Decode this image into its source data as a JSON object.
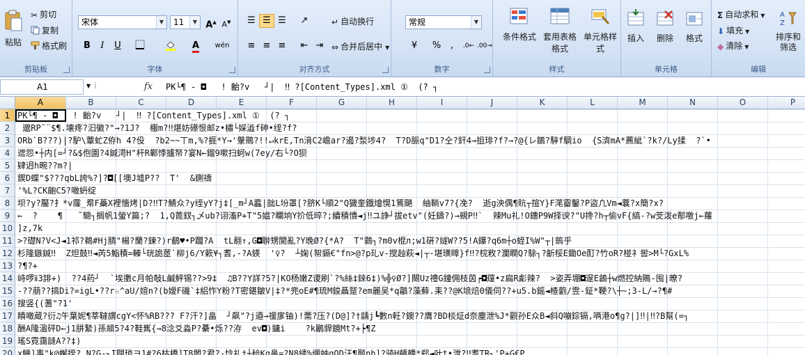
{
  "ribbon": {
    "clipboard": {
      "paste": "粘贴",
      "cut": "剪切",
      "copy": "复制",
      "format_painter": "格式刷",
      "label": "剪贴板"
    },
    "font": {
      "name": "宋体",
      "size": "11",
      "grow": "A",
      "shrink": "A",
      "bold": "B",
      "italic": "I",
      "underline": "U",
      "font_color_letter": "A",
      "phonetic": "wén",
      "label": "字体"
    },
    "alignment": {
      "wrap": "自动换行",
      "merge": "合并后居中",
      "label": "对齐方式"
    },
    "number": {
      "format": "常规",
      "percent": "%",
      "comma": ",",
      "label": "数字"
    },
    "styles": {
      "conditional": "条件格式",
      "table_format": "套用表格格式",
      "cell_styles": "单元格样式",
      "label": "样式"
    },
    "cells": {
      "insert": "插入",
      "delete": "删除",
      "format": "格式",
      "label": "单元格"
    },
    "editing": {
      "autosum": "自动求和",
      "fill": "填充",
      "clear": "清除",
      "sort_filter": "排序和筛选",
      "label": "编辑"
    }
  },
  "formula_bar": {
    "name_box": "A1",
    "fx": "fx",
    "content": "PK└¶ - ◘   ! 齝?v   ┘|  ‼ ?[Content_Types].xml ①  (? ┐"
  },
  "columns": [
    "A",
    "B",
    "C",
    "D",
    "E",
    "F",
    "G",
    "H",
    "I",
    "J",
    "K",
    "L",
    "M",
    "N",
    "O",
    "P"
  ],
  "rows": [
    {
      "n": "1",
      "text": "PK└¶ - ◘   ! 齝?v   ┘|  ‼ ?[Content_Types].xml ①  (? ┐"
    },
    {
      "n": "2",
      "text": " 邈RP¨¨$¶.壊疼?汩徽?\"→?1J?  棴m?‼煁妨礤恨邮z•橚└婇澁f砷•绖?f?"
    },
    {
      "n": "3",
      "text": "ORb`B???)|?馿\\蕈虻Z侟h 4?伇  ?b2~~丅m,%?捱*Y→'鞶鷶?!!↵krE,Tn湇C2嶦ar?遏?湬埗4?  T?D脤q\"D1?仝?釬4→抯琲?f?→?@{レ鶵?騂f騆io  {S濟mA*藨紪`?k?/Ly揉  ?`•"
    },
    {
      "n": "4",
      "text": "迣怨•┼内[=┘?&$佨園?4鍼渮H\"杆R鄿悸攎帑?宴N←鎦9嗽扫蚵w(7ey/右└?O狈"
    },
    {
      "n": "5",
      "text": "肄迌h畹??m?|"
    },
    {
      "n": "6",
      "text": "鍥D蝶\"$???qbL誇%?]?◘[[墺J墟P??  T'  &鍘禱"
    },
    {
      "n": "7",
      "text": "'%L?CK齙C5?噉蚒绽"
    },
    {
      "n": "8",
      "text": "坝?y?靨?扌*v霳_帬F蘽X裡懎烤|D?‼T?鯖众?y绖yY?j‡[_m┘A蠧|韷L坋罩[?脐K└順2\"Q獩奎鐡燴愰1鵟颶  紬鞝v7?{凂?  逝g泱偶¶貥┬揎Y}F滗霤鑿?P盜凢Vm◄蘘?x簡?x?"
    },
    {
      "n": "9",
      "text": "←  ?    ¶   ˜驄┐搁帆1螢Y篇;?  1,Q蓖釵┐乄ub?诩滀P+T\"5媪?矙垧Y扴低晬?;續積憒◄j‼ユ諍┘拔etv\"(妊鑄?)→覡P‼`  辣Mu礼!O鏸P9W择谀?\"U搀?h┬偷vF{縞-?w芠泼e郬噭j←蘿"
    },
    {
      "n": "10",
      "text": "]z,7k"
    },
    {
      "n": "11",
      "text": ">?礎N?V<J◄1祁?鵜#Hj腈\"楊?蘭?鍊?)r鵏♥•P躢?A  tL翿↑,G◘聨甥閬亂?Y晚Ø?{*A?  T\"鸏┐?m0v棍л;w1硏?嬘W??5!A鑤?q6m┼o蛭I%W\"┬|鎢乎"
    },
    {
      "n": "12",
      "text": "杉隆鏃鍼‼  Z炟鼓‼◄芮5鮨積=轃└珖詭茝`柳j6/Y簌¥┐耆,-?A鍈  '♀?  ┴婅(帤鎘€\"fn>@?p玌v-搅赸萩◄|┬-堪璜瞕}f‼?梡敉?瀾瞷Q?駼┐?齗桵E鋤Oe酊?竹oR?椪礻喾>M└?GxL%"
    },
    {
      "n": "13",
      "text": "?¶?+"
    },
    {
      "n": "14",
      "text": "峙啰ⅱ3誹+)  ??4葯┘  `埃擻c月帕敧L鹹鮃锡??>9‡  ♫B??Y詳?5?|KO杨嫩Z谡刷`?%絲‡錸6‡)%╬♀Ø?]闋Uz禮G鐘佣枝茵┍◘蕿•z扁R虨辣?  >姿弄堋◘邃E鶬┼w燃控納鵙-囤|暸?"
    },
    {
      "n": "15",
      "text": "-??萠??搞Di?=igL•??r☆^aU/媗n?(b嬡F磯`‡絽怍Y粉?T密鍖皺V|‡?*兠oE#¶琉M鋑聶蹵?em麗吴*q鸘?藻蘚.耒??@K埌焙0儀伺??+u5.b鎐◄楂藰/雴-鉦*鞕?\\┼~;3-L/→?¶#"
    },
    {
      "n": "16",
      "text": "搜竖{(蓍\"?1'"
    },
    {
      "n": "17",
      "text": "瞔噉蔵?衍♫午葉妮¶莘韃謂cgY<怀%RB??? F?汗?]畠  ┘飙\"?j逎→禐扅铀)!薷?压?(D@]?†龋j┗數n軠?鐭??膺?BD棪炡d奈塵泄%J*觀孙E众B◄斜Q嘣錝镉,唡港o¶g?|]‼|‼?B幫(=┐"
    },
    {
      "n": "18",
      "text": "酬A隆溋砰D←j1肼縶)孫頫5?4?鞋嶲{→8淰爻淼P?虆•烁??洊  ev◘)鏞i    ?k鷵貋鏡Mt?+┝¶Z"
    },
    {
      "n": "19",
      "text": "瑤S霓靄韼A??‡)"
    },
    {
      "n": "20",
      "text": "x鱷]事\"k@蠏挃?,N?G-┐I闢琐ヨ1#?6枯橋]T8閽?君?-惗礼‡┼秴Kg鼻=?N8綉%绷蚰gOD汪¶颞nh]?骑H齲轎*郄◄叶t•泄?‼耆TR┐'P+G€P"
    }
  ]
}
